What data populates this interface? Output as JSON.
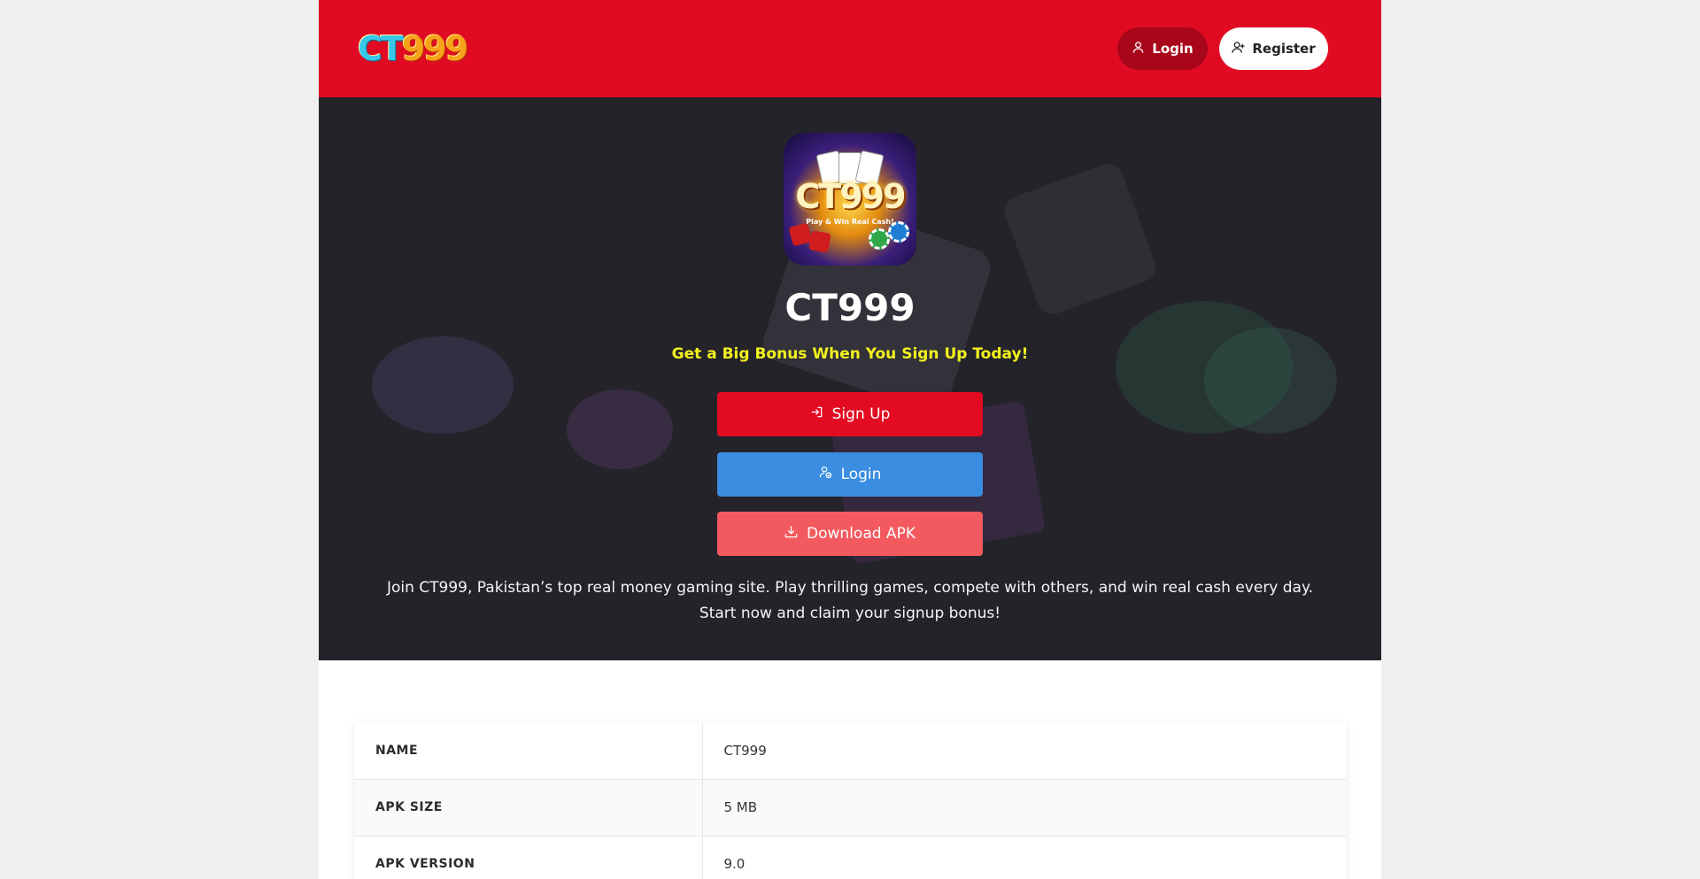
{
  "header": {
    "logo_ct": "CT",
    "logo_num": "999",
    "login_label": "Login",
    "register_label": "Register"
  },
  "hero": {
    "icon_text": "CT999",
    "icon_subtext": "Play & Win Real Cash!",
    "title": "CT999",
    "tagline": "Get a Big Bonus When You Sign Up Today!",
    "signup_label": "Sign Up",
    "login_label": "Login",
    "download_label": "Download APK",
    "description": "Join CT999, Pakistan’s top real money gaming site. Play thrilling games, compete with others, and win real cash every day. Start now and claim your signup bonus!"
  },
  "info_table": [
    {
      "key": "NAME",
      "value": "CT999"
    },
    {
      "key": "APK SIZE",
      "value": "5 MB"
    },
    {
      "key": "APK VERSION",
      "value": "9.0"
    }
  ],
  "colors": {
    "header_red": "#e00b22",
    "signup_red": "#e20b22",
    "login_blue": "#3a8de0",
    "download_coral": "#f35a5f",
    "tagline_yellow": "#f2f21e"
  }
}
